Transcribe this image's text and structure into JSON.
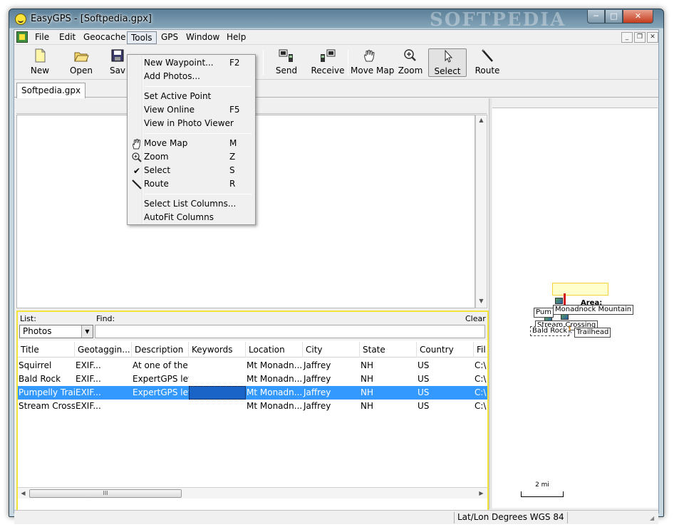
{
  "window": {
    "title": "EasyGPS - [Softpedia.gpx]",
    "watermark": "SOFTPEDIA",
    "minimize_glyph": "─",
    "maximize_glyph": "□",
    "close_glyph": "✕"
  },
  "menubar": {
    "items": [
      "File",
      "Edit",
      "Geocache",
      "Tools",
      "GPS",
      "Window",
      "Help"
    ],
    "mdi_min": "_",
    "mdi_restore": "❐",
    "mdi_close": "✕"
  },
  "toolbar": {
    "new": "New",
    "open": "Open",
    "save": "Sav",
    "send": "Send",
    "receive": "Receive",
    "move_map": "Move Map",
    "zoom": "Zoom",
    "select": "Select",
    "route": "Route"
  },
  "tabs": {
    "file": "Softpedia.gpx"
  },
  "tools_menu": {
    "new_waypoint": "New Waypoint...",
    "new_waypoint_key": "F2",
    "add_photos": "Add Photos...",
    "set_active_point": "Set Active Point",
    "view_online": "View Online",
    "view_online_key": "F5",
    "view_photo_viewer": "View in Photo Viewer",
    "move_map": "Move Map",
    "move_map_key": "M",
    "zoom": "Zoom",
    "zoom_key": "Z",
    "select": "Select",
    "select_key": "S",
    "route": "Route",
    "route_key": "R",
    "select_list_columns": "Select List Columns...",
    "autofit_columns": "AutoFit Columns",
    "check_glyph": "✔"
  },
  "list": {
    "list_label": "List:",
    "find_label": "Find:",
    "clear_label": "Clear",
    "selected_list": "Photos",
    "find_value": "",
    "columns": [
      "Title",
      "Geotaggin...",
      "Description",
      "Keywords",
      "Location",
      "City",
      "State",
      "Country",
      "Fil"
    ],
    "rows": [
      [
        "Squirrel",
        "EXIF...",
        "At one of the...",
        "",
        "Mt Monadn...",
        "Jaffrey",
        "NH",
        "US",
        "C:\\"
      ],
      [
        "Bald Rock",
        "EXIF...",
        "ExpertGPS let...",
        "",
        "Mt Monadn...",
        "Jaffrey",
        "NH",
        "US",
        "C:\\"
      ],
      [
        "Pumpelly Trail",
        "EXIF...",
        "ExpertGPS let...",
        "",
        "Mt Monadn...",
        "Jaffrey",
        "NH",
        "US",
        "C:\\"
      ],
      [
        "Stream Cross...",
        "EXIF...",
        "",
        "",
        "Mt Monadn...",
        "Jaffrey",
        "NH",
        "US",
        "C:\\"
      ]
    ],
    "selected_row": 2,
    "scroll_grip": "III"
  },
  "map": {
    "labels": {
      "monadnock": "Monadnock Mountain",
      "pumpelly": "Pum",
      "stream": "Stream Crossing",
      "bald": "Bald Rock",
      "trailhead": "Trailhead",
      "area": "Area:"
    },
    "scale": "2 mi"
  },
  "status": {
    "coords": "Lat/Lon Degrees WGS 84"
  },
  "colors": {
    "selection": "#3399ff",
    "list_highlight_border": "#f2e43a",
    "area_fill": "#ffffcc"
  }
}
